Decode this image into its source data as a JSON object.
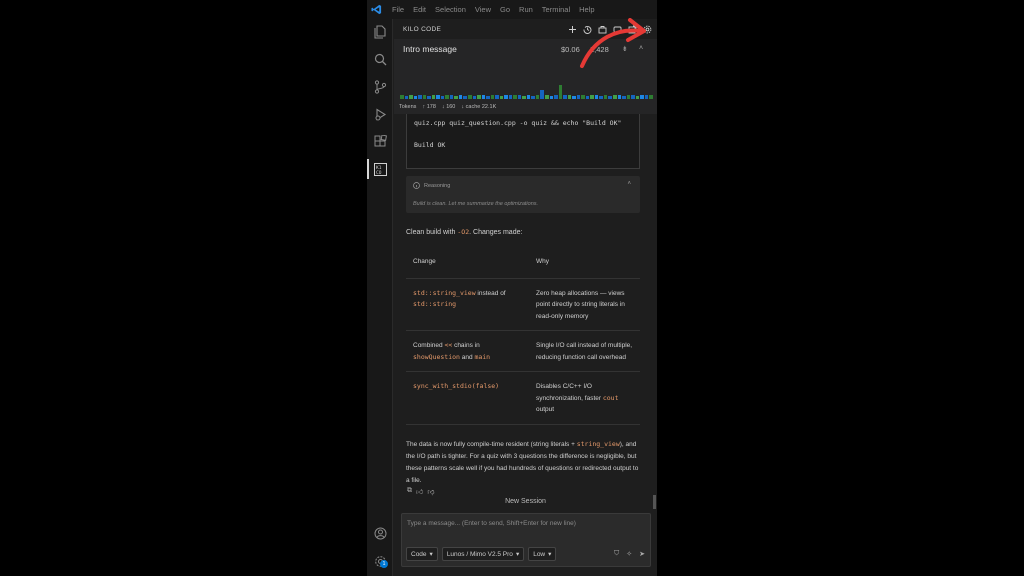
{
  "menubar": {
    "items": [
      "File",
      "Edit",
      "Selection",
      "View",
      "Go",
      "Run",
      "Terminal",
      "Help"
    ]
  },
  "activity_bar": {
    "icons": [
      "files-icon",
      "search-icon",
      "source-control-icon",
      "run-debug-icon",
      "extensions-icon",
      "kilo-code-icon"
    ],
    "bottom_icons": [
      "account-icon",
      "settings-icon"
    ],
    "settings_badge": "1"
  },
  "panel": {
    "title": "KILO CODE",
    "actions": [
      "plus-icon",
      "history-icon",
      "marketplace-icon",
      "mcp-icon",
      "popout-icon",
      "settings-icon"
    ]
  },
  "task": {
    "title": "Intro message",
    "cost": "$0.06",
    "context": "2,428",
    "tokens_label": "Tokens",
    "tokens_up": "178",
    "tokens_down": "160",
    "cache": "cache 22.1K",
    "bar_colors": [
      "#2e7d32",
      "#1565c0",
      "#43a047",
      "#1e88e5",
      "#1565c0"
    ]
  },
  "messages": {
    "command": "quiz.cpp quiz_question.cpp -o quiz && echo \"Build OK\"",
    "command_output": "Build OK",
    "reasoning_label": "Reasoning",
    "reasoning_text": "Build is clean. Let me summarize the optimizations.",
    "summary_pre": "Clean build with ",
    "summary_flag": "-O2",
    "summary_post": ". Changes made:",
    "table": {
      "headers": [
        "Change",
        "Why"
      ],
      "rows": [
        {
          "change_parts": [
            {
              "text": "std::string_view",
              "code": true
            },
            {
              "text": " instead of ",
              "code": false
            },
            {
              "text": "std::string",
              "code": true
            }
          ],
          "why": "Zero heap allocations — views point directly to string literals in read-only memory"
        },
        {
          "change_parts": [
            {
              "text": "Combined ",
              "code": false
            },
            {
              "text": "<<",
              "code": true
            },
            {
              "text": " chains in ",
              "code": false
            },
            {
              "text": "showQuestion",
              "code": true
            },
            {
              "text": " and ",
              "code": false
            },
            {
              "text": "main",
              "code": true
            }
          ],
          "why": "Single I/O call instead of multiple, reducing function call overhead"
        },
        {
          "change_parts": [
            {
              "text": "sync_with_stdio(false)",
              "code": true
            }
          ],
          "why_parts": [
            {
              "text": "Disables C/C++ I/O synchronization, faster ",
              "code": false
            },
            {
              "text": "cout",
              "code": true
            },
            {
              "text": " output",
              "code": false
            }
          ]
        }
      ]
    },
    "closing_1": "The data is now fully compile-time resident (string literals + ",
    "closing_code": "string_view",
    "closing_2": "), and the I/O path is tighter. For a quiz with 3 questions the difference is negligible, but these patterns scale well if you had hundreds of questions or redirected output to a file."
  },
  "new_session_label": "New Session",
  "chat": {
    "placeholder": "Type a message... (Enter to send, Shift+Enter for new line)",
    "mode": "Code",
    "model": "Lunos / Mimo V2.5 Pro",
    "effort": "Low"
  }
}
